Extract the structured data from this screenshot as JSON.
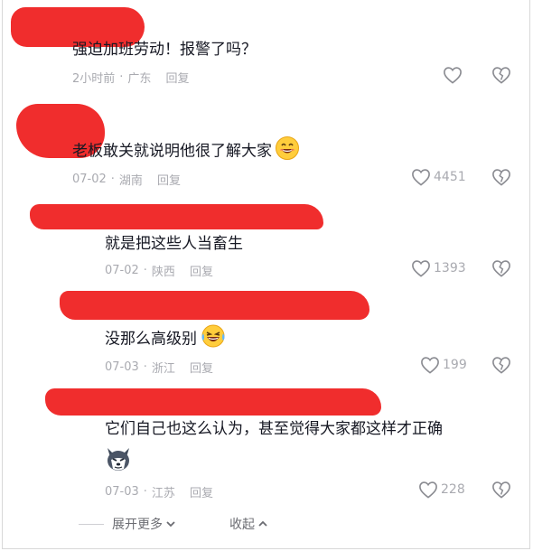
{
  "comments": [
    {
      "text": "强迫加班劳动！报警了吗？",
      "time": "2小时前",
      "location": "广东",
      "reply": "回复",
      "likes": ""
    },
    {
      "text": "老板敢关就说明他很了解大家",
      "time": "07-02",
      "location": "湖南",
      "reply": "回复",
      "likes": "4451",
      "emoji": "grin-emoji"
    },
    {
      "text": "就是把这些人当畜生",
      "time": "07-02",
      "location": "陕西",
      "reply": "回复",
      "likes": "1393"
    },
    {
      "text": "没那么高级别",
      "time": "07-03",
      "location": "浙江",
      "reply": "回复",
      "likes": "199",
      "emoji": "laugh-cry-emoji"
    },
    {
      "text": "它们自己也这么认为，甚至觉得大家都这样才正确",
      "time": "07-03",
      "location": "江苏",
      "reply": "回复",
      "likes": "228",
      "emoji": "husky-dog-emoji"
    }
  ],
  "footer": {
    "expand": "展开更多",
    "collapse": "收起"
  },
  "colors": {
    "redaction": "#f02d2d",
    "meta": "#a9aab0",
    "text": "#161823"
  }
}
